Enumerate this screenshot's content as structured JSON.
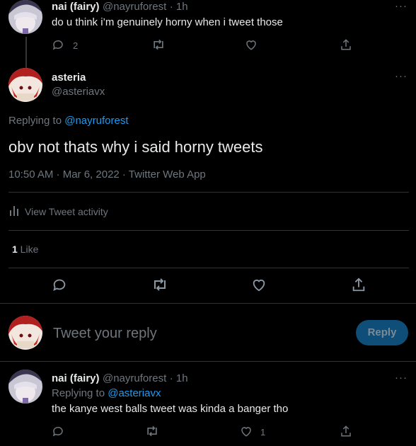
{
  "tweet1": {
    "name": "nai (fairy)",
    "handle": "@nayruforest",
    "time": "· 1h",
    "text": "do u think i’m genuinely horny when i tweet those",
    "reply_count": "2",
    "more": "···"
  },
  "main": {
    "name": "asteria",
    "handle": "@asteriavx",
    "more": "···",
    "replying_prefix": "Replying to ",
    "replying_handle": "@nayruforest",
    "text": "obv not thats why i said horny tweets",
    "timestamp": "10:50 AM · Mar 6, 2022 · Twitter Web App",
    "activity_label": "View Tweet activity",
    "likes_count": "1",
    "likes_label": " Like"
  },
  "composer": {
    "placeholder": "Tweet your reply",
    "button": "Reply"
  },
  "tweet3": {
    "name": "nai (fairy)",
    "handle": "@nayruforest",
    "time": "· 1h",
    "replying_prefix": "Replying to ",
    "replying_handle": "@asteriavx",
    "text": "the kanye west balls tweet was kinda a banger tho",
    "like_count": "1",
    "more": "···"
  },
  "colors": {
    "background": "#000000",
    "link": "#1d9bf0",
    "muted": "#6e767d",
    "reply_button": "#0f4e78"
  },
  "icons": [
    "reply-icon",
    "retweet-icon",
    "like-icon",
    "share-icon",
    "analytics-icon"
  ]
}
